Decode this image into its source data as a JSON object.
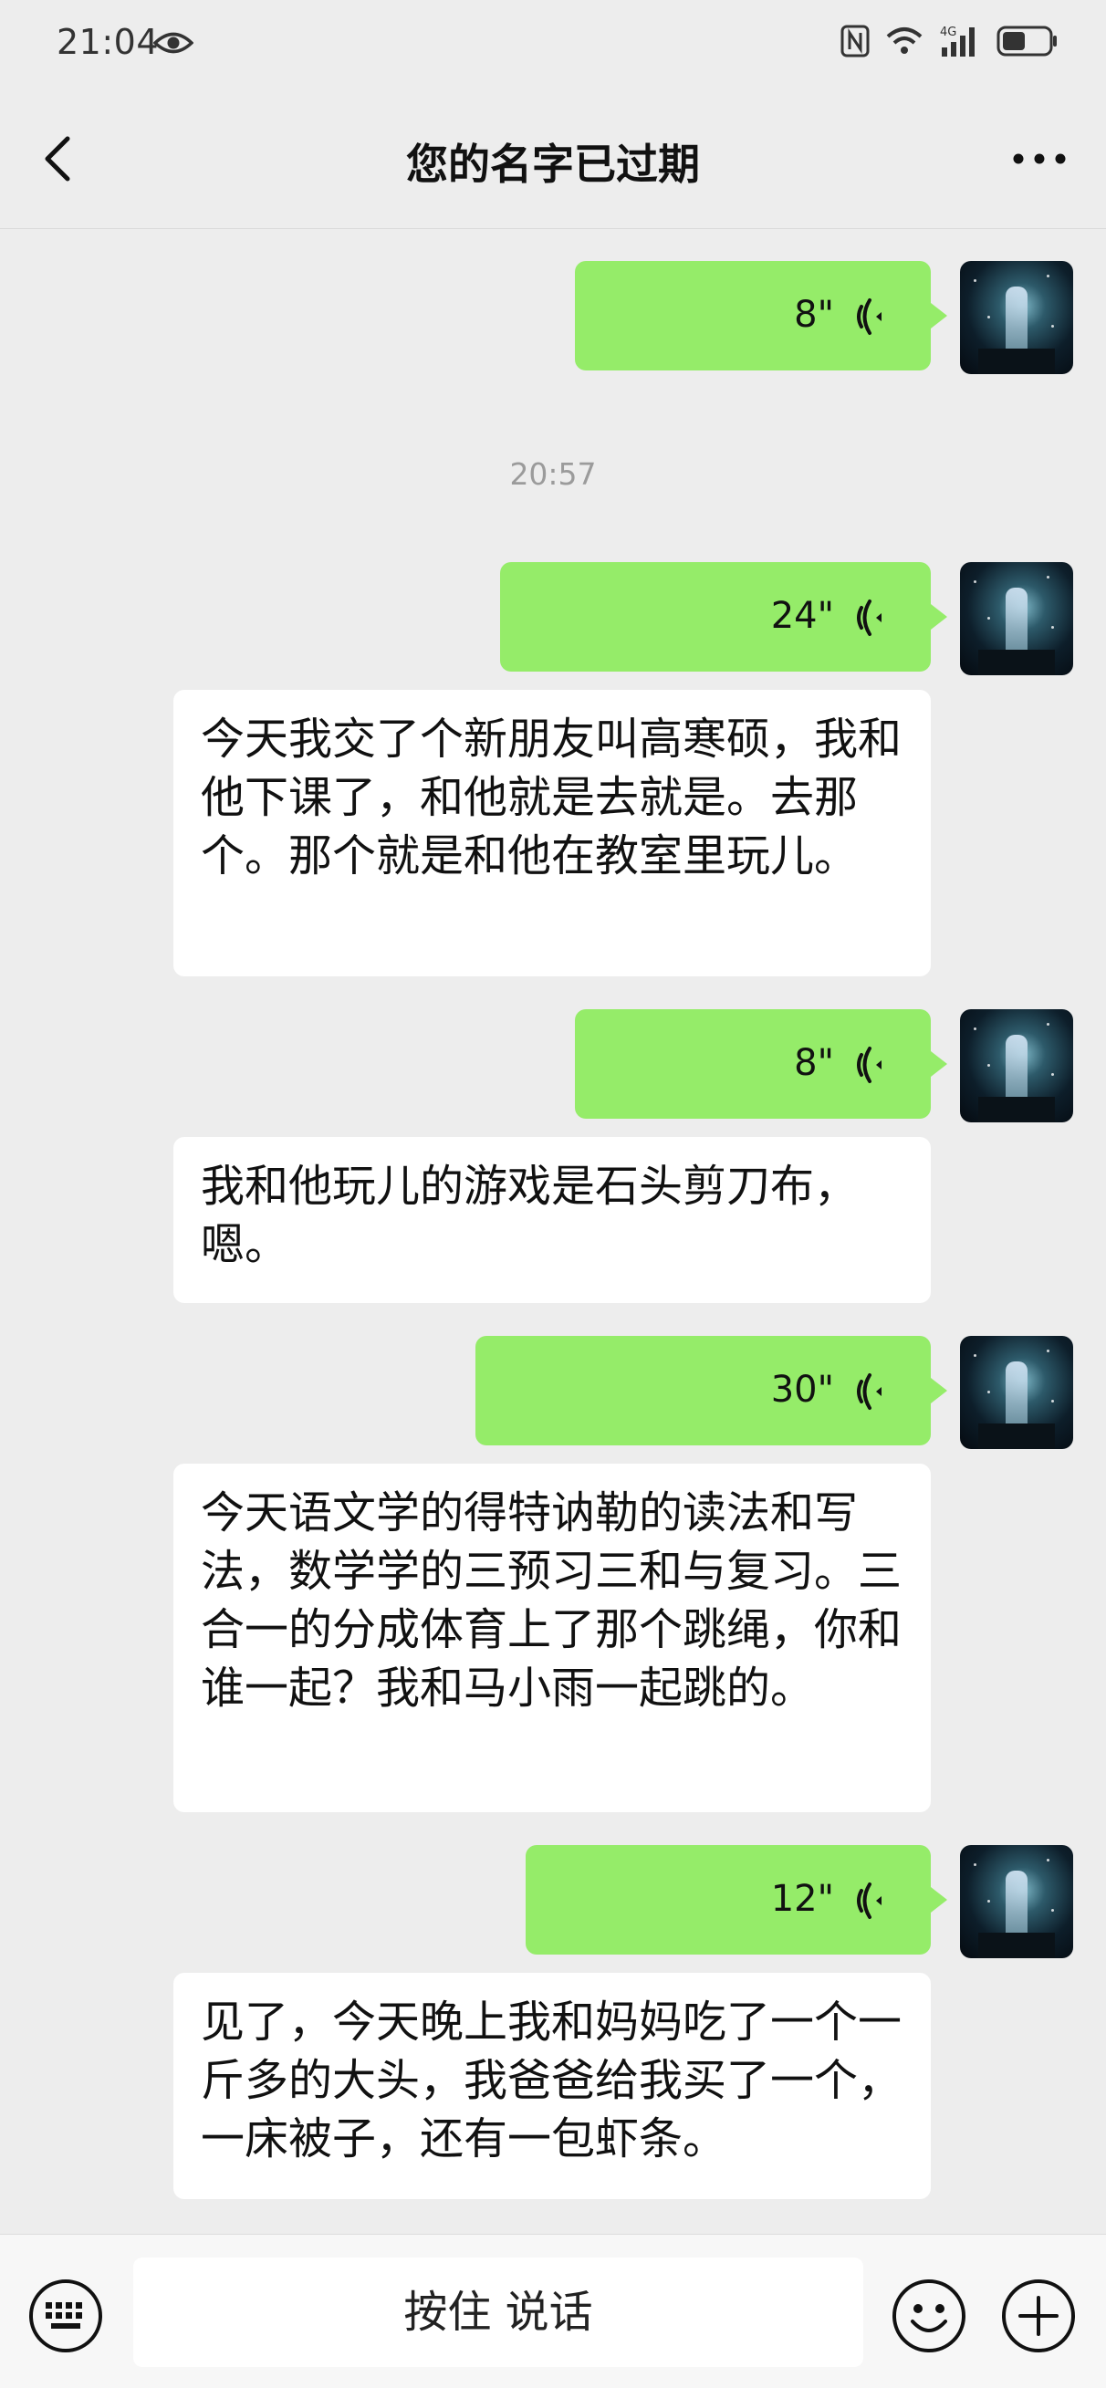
{
  "status_bar": {
    "time": "21:04",
    "network": "4G"
  },
  "header": {
    "title": "您的名字已过期"
  },
  "timestamp": "20:57",
  "messages": [
    {
      "duration": "8\""
    },
    {
      "duration": "24\"",
      "transcript": "今天我交了个新朋友叫高寒硕，我和他下课了，和他就是去就是。去那个。那个就是和他在教室里玩儿。"
    },
    {
      "duration": "8\"",
      "transcript": "我和他玩儿的游戏是石头剪刀布，嗯。"
    },
    {
      "duration": "30\"",
      "transcript": "今天语文学的得特讷勒的读法和写法，数学学的三预习三和与复习。三合一的分成体育上了那个跳绳，你和谁一起？我和马小雨一起跳的。"
    },
    {
      "duration": "12\"",
      "transcript": "见了，今天晚上我和妈妈吃了一个一斤多的大头，我爸爸给我买了一个，一床被子，还有一包虾条。"
    }
  ],
  "input_bar": {
    "talk_label": "按住 说话"
  },
  "colors": {
    "voice_bubble": "#95EC69",
    "background": "#EDEDED",
    "text_bubble": "#FFFFFF"
  },
  "icons": [
    "eye-icon",
    "nfc-icon",
    "wifi-icon",
    "signal-icon",
    "battery-icon",
    "back-arrow-icon",
    "more-icon",
    "voice-wave-icon",
    "keyboard-icon",
    "emoji-icon",
    "plus-icon"
  ]
}
